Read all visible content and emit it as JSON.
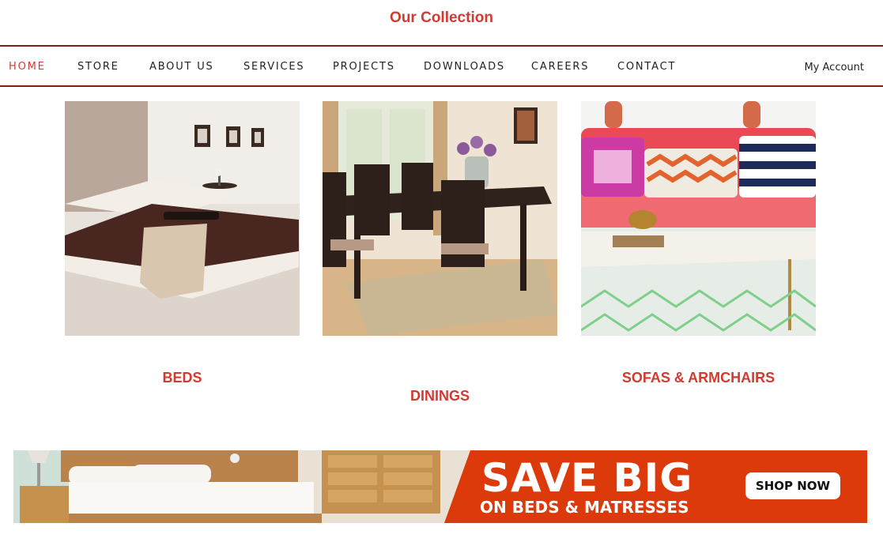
{
  "header": {
    "title": "Our Collection"
  },
  "nav": {
    "items": [
      {
        "label": "HOME",
        "active": true
      },
      {
        "label": "STORE"
      },
      {
        "label": "ABOUT US"
      },
      {
        "label": "SERVICES"
      },
      {
        "label": "PROJECTS"
      },
      {
        "label": "DOWNLOADS"
      },
      {
        "label": "CAREERS"
      },
      {
        "label": "CONTACT"
      }
    ],
    "account": "My Account"
  },
  "collection": {
    "items": [
      {
        "label": "BEDS",
        "image": "bed-photo"
      },
      {
        "label": "DININGS",
        "image": "dining-set-photo"
      },
      {
        "label": "SOFAS & ARMCHAIRS",
        "image": "sofa-photo"
      }
    ]
  },
  "banner": {
    "headline": "SAVE BIG",
    "subline": "ON BEDS & MATRESSES",
    "cta": "SHOP NOW",
    "accent_color": "#dd3a0c"
  },
  "colors": {
    "brand": "#d33a31",
    "nav_border": "#8e1a14"
  }
}
